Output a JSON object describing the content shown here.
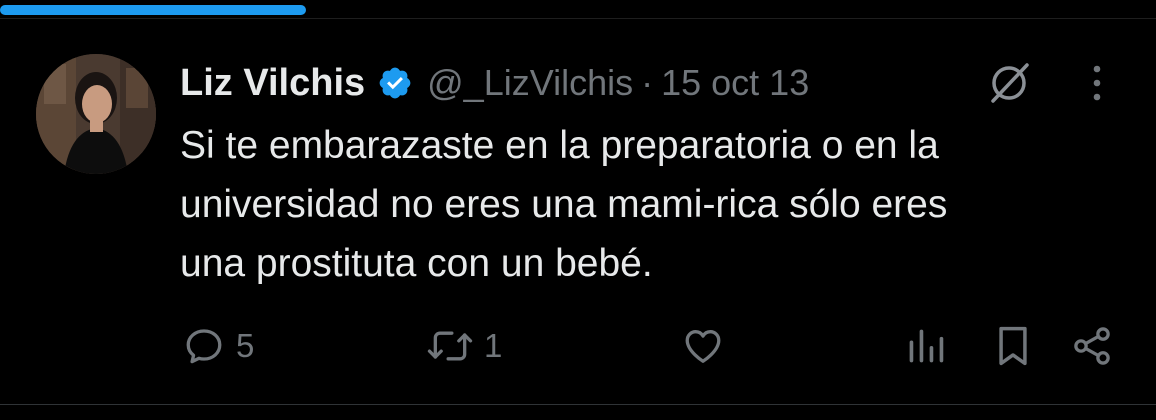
{
  "progress": {
    "fraction": 0.265,
    "color": "#1d9bf0"
  },
  "author": {
    "name": "Liz Vilchis",
    "handle": "@_LizVilchis",
    "separator": "·",
    "date": "15 oct 13",
    "verified": true,
    "verified_color": "#1d9bf0"
  },
  "header_icons": [
    "grok-icon",
    "more-vertical-icon"
  ],
  "tweet": {
    "text": "Si te embarazaste en la preparatoria o en la\nuniversidad no eres una mami-rica sólo eres\nuna prostituta con un bebé."
  },
  "actions": {
    "reply": {
      "icon": "reply-icon",
      "count": "5"
    },
    "retweet": {
      "icon": "retweet-icon",
      "count": "1"
    },
    "like": {
      "icon": "heart-icon",
      "count": ""
    },
    "views": {
      "icon": "views-icon"
    },
    "bookmark": {
      "icon": "bookmark-icon"
    },
    "share": {
      "icon": "share-icon"
    }
  },
  "colors": {
    "background": "#000000",
    "text": "#e7e9ea",
    "secondary": "#71767b",
    "accent": "#1d9bf0"
  }
}
